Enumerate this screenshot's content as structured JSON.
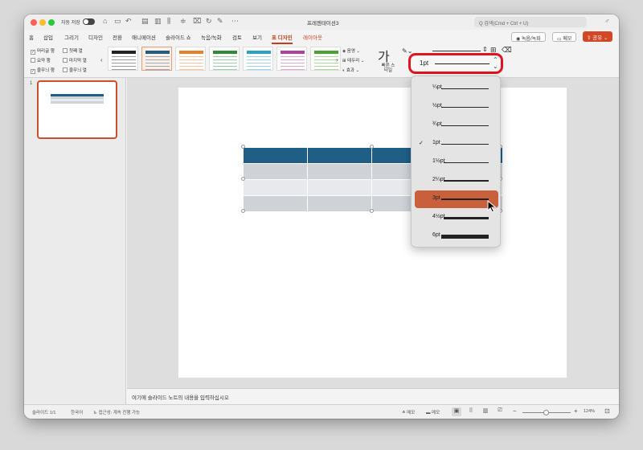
{
  "window": {
    "autosave_label": "자동 저장",
    "doc_title": "프레젠테이션3",
    "search_placeholder": "Q 검색(Cmd + Ctrl + U)"
  },
  "tabs": [
    "홈",
    "삽입",
    "그리기",
    "디자인",
    "전환",
    "애니메이션",
    "슬라이드 쇼",
    "녹음/녹화",
    "검토",
    "보기",
    "표 디자인",
    "레이아웃"
  ],
  "active_tab": "표 디자인",
  "header_buttons": {
    "record": "◉ 녹음/녹화",
    "memo": "메모",
    "share": "공유"
  },
  "table_style_options": [
    {
      "label": "머리글 행",
      "checked": true
    },
    {
      "label": "요약 행",
      "checked": false
    },
    {
      "label": "줄무늬 행",
      "checked": true
    },
    {
      "label": "첫째 열",
      "checked": false
    },
    {
      "label": "마지막 열",
      "checked": false
    },
    {
      "label": "줄무늬 열",
      "checked": false
    }
  ],
  "table_styles": [
    {
      "color": "#222222"
    },
    {
      "color": "#1f5f86",
      "selected": true
    },
    {
      "color": "#e8802a"
    },
    {
      "color": "#2e8b3a"
    },
    {
      "color": "#2aa0c8"
    },
    {
      "color": "#b040a0"
    },
    {
      "color": "#4aa030"
    }
  ],
  "ribbon_small": {
    "shading": "음영",
    "borders": "테두리",
    "effects": "효과",
    "quick_styles": "빠른 스타일"
  },
  "slide_panel": {
    "slide_number": "1"
  },
  "notes": {
    "placeholder": "여기에 슬라이드 노트의 내용을 입력하십시오"
  },
  "status": {
    "slide_pos": "슬라이드 1/1",
    "language": "한국어",
    "accessibility": "접근성: 계속 진행 가능",
    "notes_btn": "메모",
    "comments_btn": "메모",
    "zoom": "124%"
  },
  "pen_weight": {
    "current": "1pt",
    "options": [
      {
        "label": "¼pt",
        "weight": 0.25
      },
      {
        "label": "½pt",
        "weight": 0.5
      },
      {
        "label": "¾pt",
        "weight": 0.75
      },
      {
        "label": "1pt",
        "weight": 1,
        "checked": true
      },
      {
        "label": "1½pt",
        "weight": 1.5
      },
      {
        "label": "2¼pt",
        "weight": 2.25
      },
      {
        "label": "3pt",
        "weight": 3,
        "highlighted": true
      },
      {
        "label": "4½pt",
        "weight": 4.5
      },
      {
        "label": "6pt",
        "weight": 6
      }
    ]
  },
  "colors": {
    "accent": "#c43e1c",
    "table_header": "#1f5f86",
    "table_band": "#cfd3d8",
    "highlight": "#c8603c",
    "callout": "#e0141e"
  }
}
